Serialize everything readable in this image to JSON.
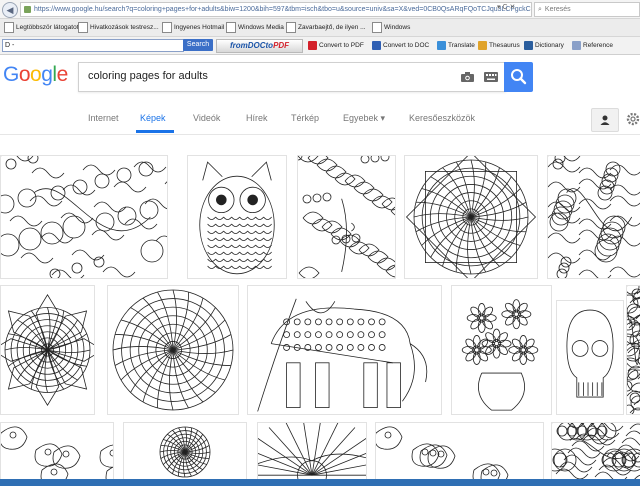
{
  "browser": {
    "url": "https://www.google.hu/search?q=coloring+pages+for+adults&biw=1200&bih=597&tbm=isch&tbo=u&source=univ&sa=X&ved=0CB0QsARqFQoTCJqu3LCFgckC",
    "search_placeholder": "Keresés"
  },
  "bookmarks": [
    {
      "label": "Legtöbbször látogatott"
    },
    {
      "label": "Hivatkozások testresz..."
    },
    {
      "label": "Ingyenes Hotmail"
    },
    {
      "label": "Windows Media"
    },
    {
      "label": "Zavarbaejtő, de ilyen ..."
    },
    {
      "label": "Windows"
    }
  ],
  "toolbar": {
    "input_value": "D -",
    "search_label": "Search",
    "fromdoc_prefix": "from",
    "fromdoc_doc": "DOC",
    "fromdoc_to": "to",
    "fromdoc_pdf": "PDF",
    "convert_pdf": "Convert to PDF",
    "convert_doc": "Convert to DOC",
    "translate": "Translate",
    "thesaurus": "Thesaurus",
    "dictionary": "Dictionary",
    "reference": "Reference"
  },
  "google": {
    "logo_letters": [
      "G",
      "o",
      "o",
      "g",
      "l",
      "e"
    ],
    "logo_colors": [
      "#4285F4",
      "#EA4335",
      "#FBBC05",
      "#4285F4",
      "#34A853",
      "#EA4335"
    ],
    "query": "coloring pages for adults"
  },
  "tabs": [
    {
      "label": "Internet"
    },
    {
      "label": "Képek",
      "active": true
    },
    {
      "label": "Videók"
    },
    {
      "label": "Hírek"
    },
    {
      "label": "Térkép"
    },
    {
      "label": "Egyebek ▾"
    },
    {
      "label": "Keresőeszközök"
    }
  ],
  "images": [
    {
      "name": "doodle-pattern",
      "pattern": "swirl"
    },
    {
      "name": "owl",
      "pattern": "owl"
    },
    {
      "name": "floral-face",
      "pattern": "leaves"
    },
    {
      "name": "square-mandala",
      "pattern": "mandala-square"
    },
    {
      "name": "owl-heart",
      "pattern": "swirl"
    },
    {
      "name": "star-mandala",
      "pattern": "star"
    },
    {
      "name": "round-mandala",
      "pattern": "mandala"
    },
    {
      "name": "elephant",
      "pattern": "elephant"
    },
    {
      "name": "flower-vase",
      "pattern": "flowers"
    },
    {
      "name": "sugar-skull",
      "pattern": "skull"
    },
    {
      "name": "paisley",
      "pattern": "paisley"
    },
    {
      "name": "dot-mandala",
      "pattern": "mandala"
    },
    {
      "name": "sunrise",
      "pattern": "sunrise"
    },
    {
      "name": "paisley-wide",
      "pattern": "paisley"
    },
    {
      "name": "pattern-corner",
      "pattern": "swirl"
    }
  ],
  "colors": {
    "accent": "#1a73e8",
    "search_button": "#4285f4",
    "toolbar_search": "#3b6fc7"
  }
}
